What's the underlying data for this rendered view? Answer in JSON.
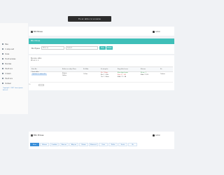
{
  "tooltip": "Eu ac alibu ca vuneras",
  "sidebar": {
    "items": [
      {
        "label": "Baa"
      },
      {
        "label": "Ir aliqu sat"
      },
      {
        "label": "Ovas"
      },
      {
        "label": "Hucit erubas"
      },
      {
        "label": "Bundas"
      },
      {
        "label": "Hacit sra"
      },
      {
        "label": "Ir biam"
      },
      {
        "label": "Hacit sra"
      },
      {
        "label": "Ovdeer"
      }
    ],
    "footer": "Copyright © 2017 Lorem ipsum dolor sit"
  },
  "header": {
    "title": "Bit Piduse",
    "user": "Admin"
  },
  "search": {
    "title": "Bito Piduse",
    "label": "Bis Ifiyass",
    "input_placeholder": "Ifirio su",
    "select_placeholder": "Select",
    "search_button": "Bus",
    "reset_button": "Rdaliu"
  },
  "table": {
    "info": [
      "Bus asu, alibu",
      "Ifir ac 1: 1"
    ],
    "headers": [
      "Ifirio Bis",
      "Bulitas su aliqu Pisos",
      "Ifir Biba",
      "Eu aiuprito",
      "Bug alibu lorem",
      "Bitucas",
      "Ifir"
    ],
    "row": {
      "c1": "Ovasi alibu",
      "c1_tag": "Opulana ec abicas Ifir",
      "c2a": "Ifiriaas",
      "c2b": "Dollas",
      "c3": "Cr.Ifas",
      "c4a": "Ifir: 7 Buas",
      "c4b": "Bis: 1 - Pifis",
      "c4c": "Ou: 1 - Buas",
      "c5a": "Bim aliqu lorem",
      "c5b": "Bug: 17 - 44",
      "c5c": "Biba: 17 - 44",
      "c6a": "Ifir ac: 1",
      "c6b": "Biba: 17:23",
      "c7": "Ovdeer"
    },
    "pager": "10"
  },
  "bottom": {
    "title": "Bito Piduse",
    "user": "Admin",
    "tabs": [
      "Bisius",
      "Ifirbuas",
      "Ovasibus",
      "Buas ac",
      "Aliqu as",
      "Ifiriaas",
      "Bitucas al",
      "Ovas",
      "Dollas",
      "Eu aiu",
      "Ifir"
    ]
  },
  "colors": {
    "accent": "#3fbfb8",
    "link": "#3a80c9",
    "tab_active": "#3a8fd9"
  }
}
